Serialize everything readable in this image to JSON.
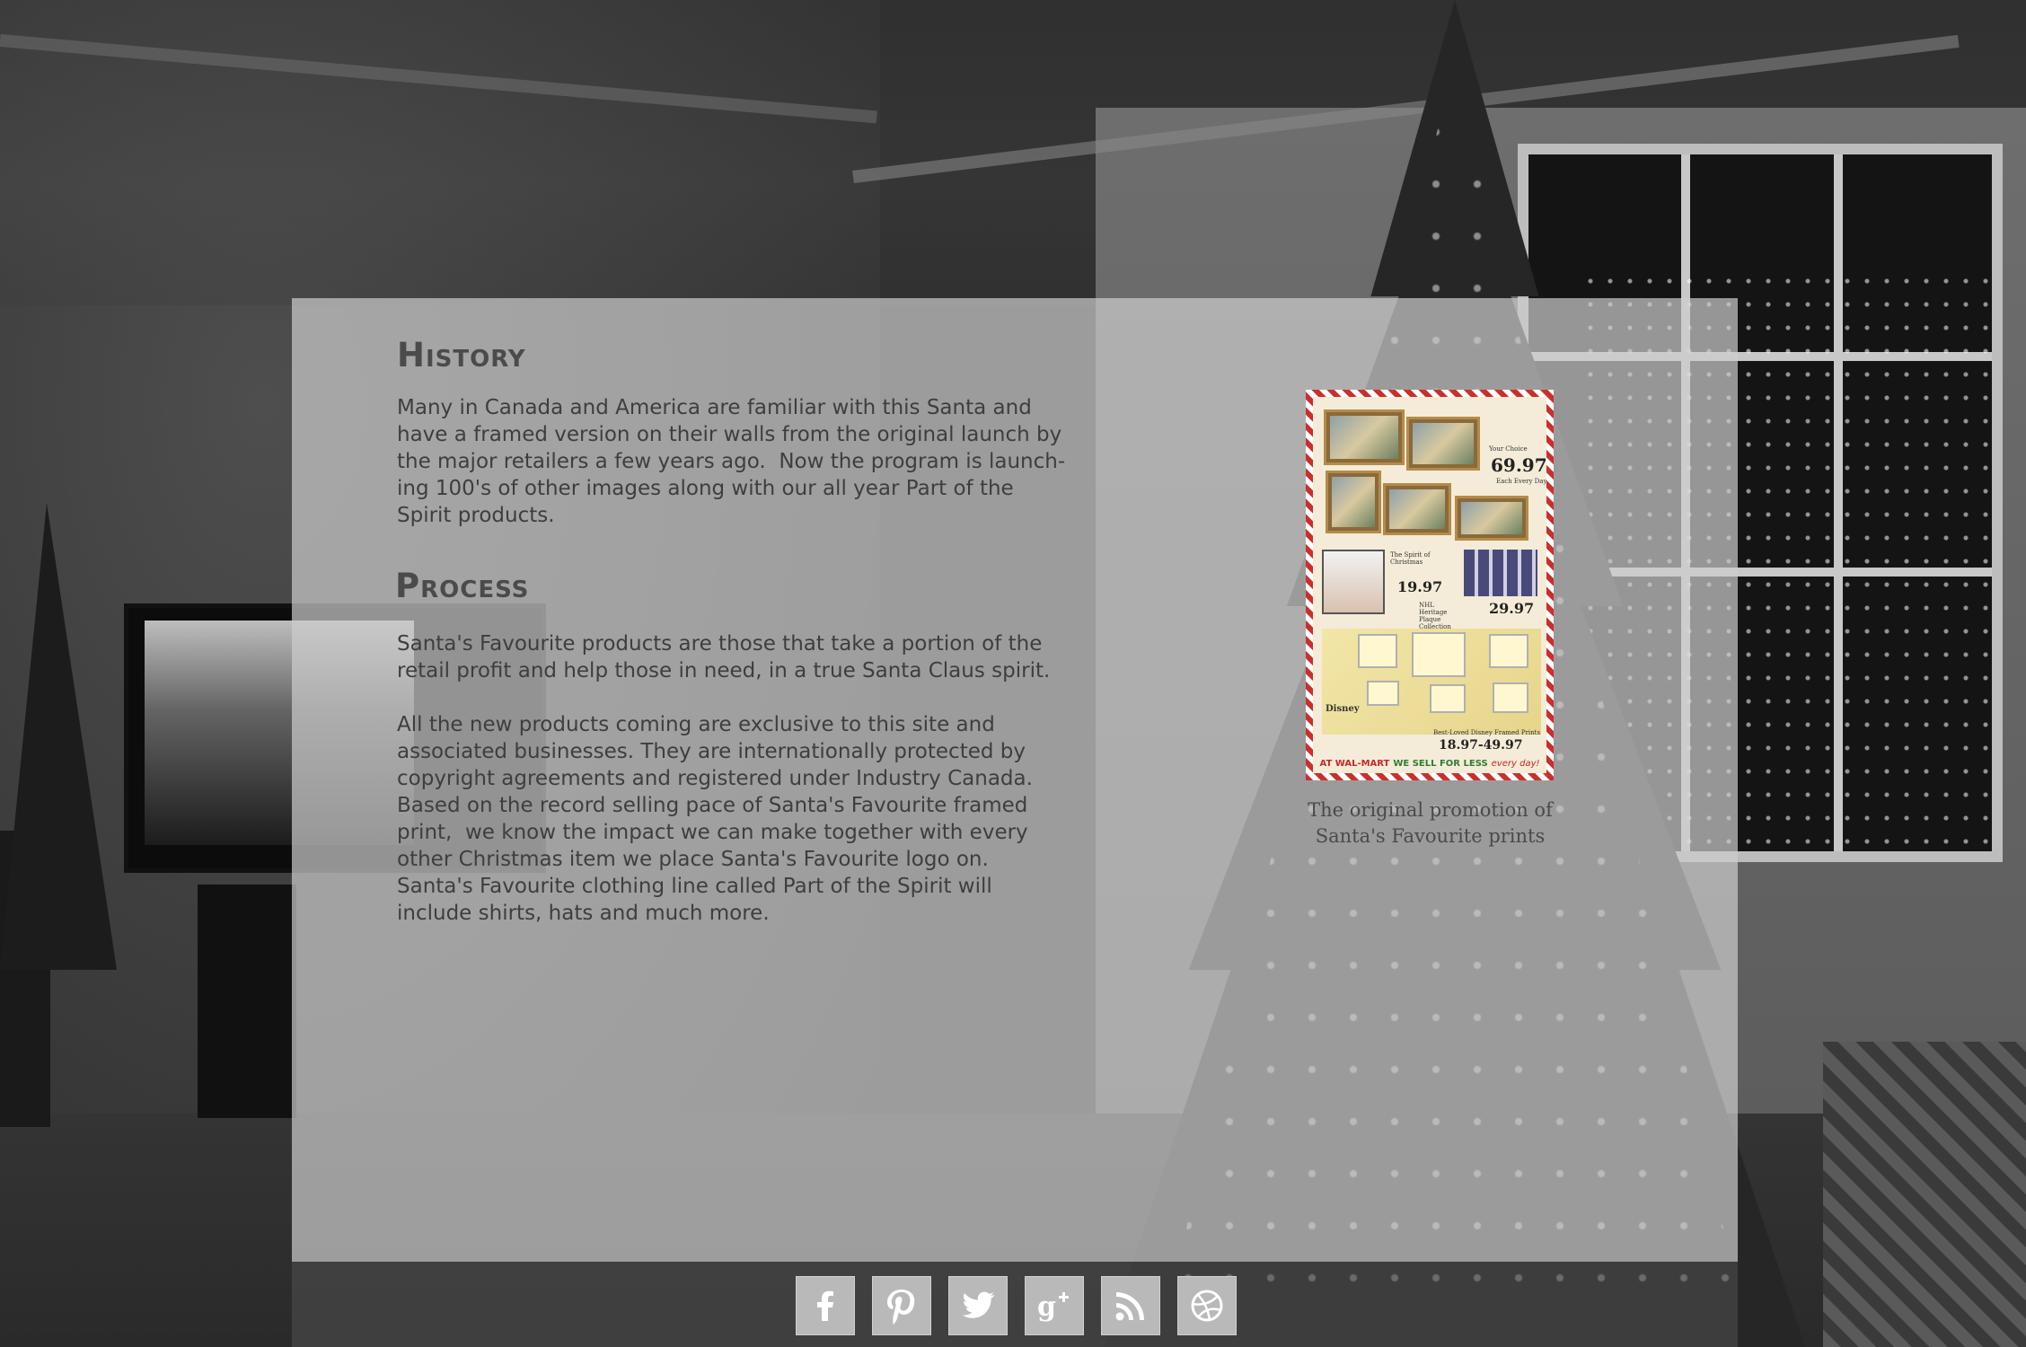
{
  "sections": {
    "history": {
      "heading": "History",
      "body": "Many in Canada and America are familiar with this Santa and\nhave a framed version on their walls from the original launch by\nthe major retailers a few years ago.  Now the program is launch-\ning 100's of other images along with our all year Part of the\nSpirit products."
    },
    "process": {
      "heading": "Process",
      "body1": "Santa's Favourite products are those that take a portion of the\nretail profit and help those in need, in a true Santa Claus spirit.",
      "body2": "All the new products coming are exclusive to this site and\nassociated businesses. They are internationally protected by\ncopyright agreements and registered under Industry Canada.\nBased on the record selling pace of Santa's Favourite framed\nprint,  we know the impact we can make together with every\nother Christmas item we place Santa's Favourite logo on.\nSanta's Favourite clothing line called Part of the Spirit will\ninclude shirts, hats and much more."
    }
  },
  "promo": {
    "caption_line1": "The original promotion of",
    "caption_line2": "Santa's Favourite prints",
    "price_1": "69.97",
    "price_2": "19.97",
    "price_3": "29.97",
    "price_4": "18.97-49.97",
    "price_label_1": "Your Choice",
    "price_label_2": "Each Every Day",
    "label_christmas": "The Spirit of Christmas",
    "label_plates": "NHL Heritage Plaque Collection",
    "label_disney": "Best-Loved Disney Framed Prints",
    "label_disney_logo": "Disney",
    "bar_store": "AT WAL-MART",
    "bar_slogan": "WE SELL FOR LESS",
    "bar_tag": "every day!"
  },
  "social": [
    {
      "name": "facebook",
      "icon": "facebook-icon"
    },
    {
      "name": "pinterest",
      "icon": "pinterest-icon"
    },
    {
      "name": "twitter",
      "icon": "twitter-icon"
    },
    {
      "name": "google-plus",
      "icon": "google-plus-icon"
    },
    {
      "name": "rss",
      "icon": "rss-icon"
    },
    {
      "name": "dribbble",
      "icon": "dribbble-icon"
    }
  ],
  "colors": {
    "panel": "#cdcdcd",
    "text": "#3e3e3e",
    "heading": "#4b4b4b",
    "social_button": "#b9b9b9",
    "social_glyph": "#ffffff"
  }
}
